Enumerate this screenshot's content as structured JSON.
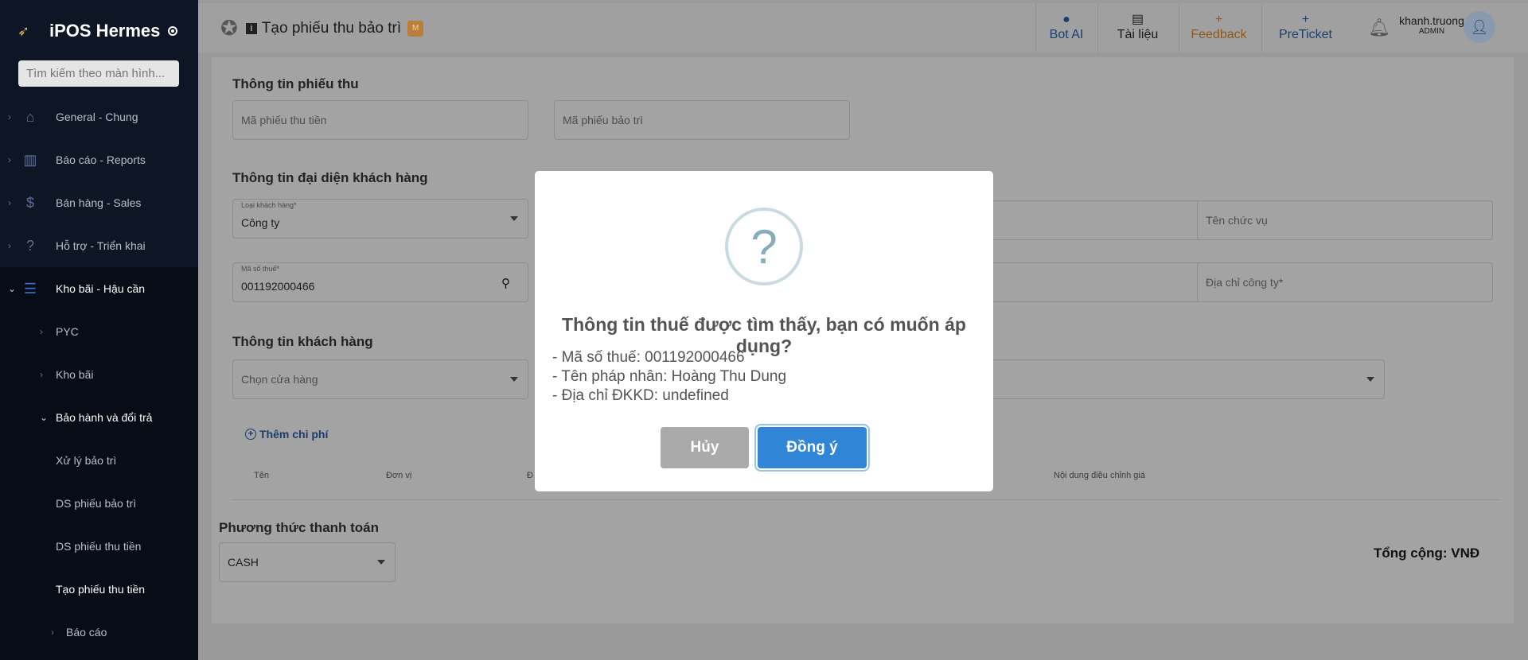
{
  "sidebar": {
    "brand": "iPOS Hermes",
    "search_placeholder": "Tìm kiếm theo màn hình...",
    "items": [
      {
        "label": "General - Chung"
      },
      {
        "label": "Báo cáo - Reports"
      },
      {
        "label": "Bán hàng - Sales"
      },
      {
        "label": "Hỗ trợ - Triển khai"
      },
      {
        "label": "Kho bãi - Hậu cần"
      },
      {
        "label": "PYC"
      },
      {
        "label": "Kho bãi"
      },
      {
        "label": "Bảo hành và đổi trả"
      },
      {
        "label": "Xử lý bảo trì"
      },
      {
        "label": "DS phiếu bảo trì"
      },
      {
        "label": "DS phiếu thu tiền"
      },
      {
        "label": "Tạo phiếu thu tiền"
      },
      {
        "label": "Báo cáo"
      }
    ]
  },
  "header": {
    "title": "Tạo phiếu thu bảo trì",
    "badge": "M",
    "bot_label": "Bot AI",
    "docs_label": "Tài liệu",
    "feedback_label": "Feedback",
    "preticket_label": "PreTicket",
    "username": "khanh.truong",
    "role": "ADMIN"
  },
  "form": {
    "section_receipt": "Thông tin phiếu thu",
    "receipt_code_placeholder": "Mã phiếu thu tiền",
    "maintenance_code_placeholder": "Mã phiếu bảo trì",
    "section_rep": "Thông tin đại diện khách hàng",
    "customer_type_label": "Loại khách hàng*",
    "customer_type_value": "Công ty",
    "position_placeholder": "Tên chức vụ",
    "tax_code_label": "Mã số thuế*",
    "tax_code_value": "001192000466",
    "company_address_placeholder": "Địa chỉ công ty*",
    "section_customer": "Thông tin khách hàng",
    "store_placeholder": "Chọn cửa hàng",
    "add_cost": "Thêm chi phí",
    "table_headers": [
      "Tên",
      "Đơn vị",
      "Đ",
      "Nội dung điều chỉnh giá"
    ],
    "section_payment": "Phương thức thanh toán",
    "payment_value": "CASH",
    "total": "Tổng cộng: VNĐ"
  },
  "modal": {
    "icon": "question-icon",
    "title": "Thông tin thuế được tìm thấy, bạn có muốn áp dụng?",
    "line1": "- Mã số thuế: 001192000466",
    "line2": "- Tên pháp nhân: Hoàng Thu Dung",
    "line3": "- Địa chỉ ĐKKD: undefined",
    "cancel_label": "Hủy",
    "ok_label": "Đồng ý"
  },
  "colors": {
    "sidebar_bg": "#0e1625",
    "confirm_button": "#3085d6",
    "cancel_button": "#aaaaaa"
  }
}
